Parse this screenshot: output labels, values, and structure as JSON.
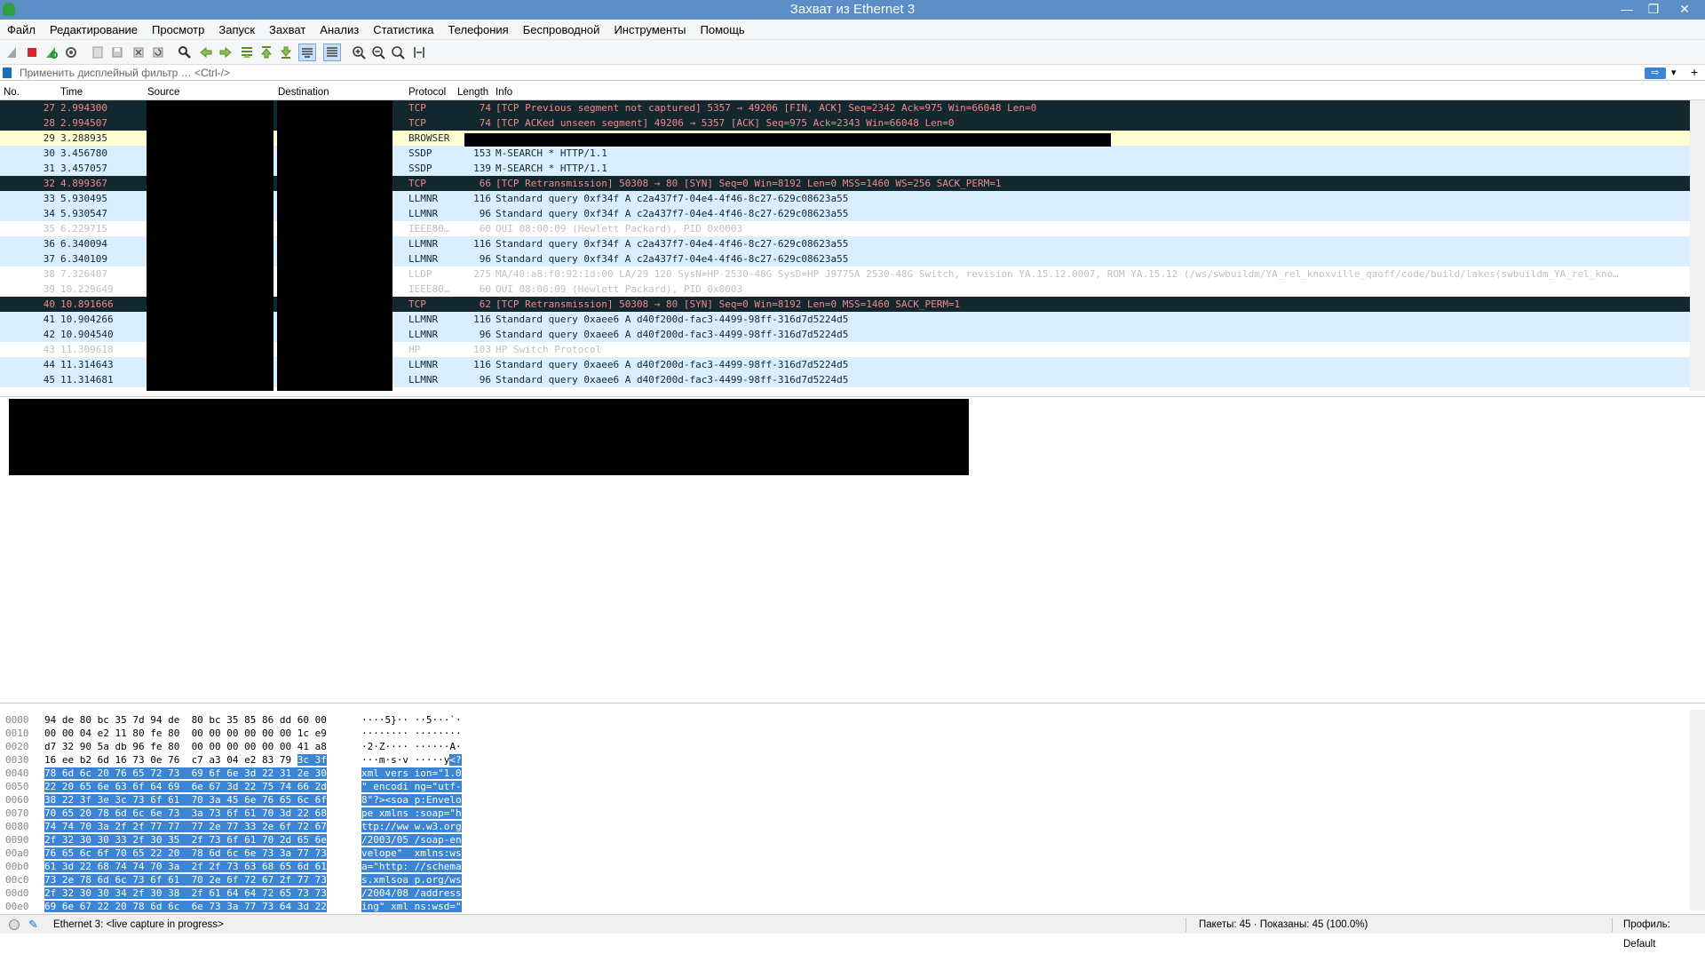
{
  "window": {
    "title": "Захват из Ethernet 3",
    "min": "—",
    "max": "❐",
    "close": "✕"
  },
  "menu": [
    "Файл",
    "Редактирование",
    "Просмотр",
    "Запуск",
    "Захват",
    "Анализ",
    "Статистика",
    "Телефония",
    "Беспроводной",
    "Инструменты",
    "Помощь"
  ],
  "filter": {
    "placeholder": "Применить дисплейный фильтр … <Ctrl-/>",
    "apply": "⇨",
    "dropdown": "▾",
    "add": "+"
  },
  "columns": {
    "no": "No.",
    "time": "Time",
    "source": "Source",
    "destination": "Destination",
    "protocol": "Protocol",
    "length": "Length",
    "info": "Info"
  },
  "packets": [
    {
      "no": "27",
      "time": "2.994300",
      "proto": "TCP",
      "len": "74",
      "info": "[TCP Previous segment not captured] 5357 → 49206 [FIN, ACK] Seq=2342 Ack=975 Win=66048 Len=0",
      "style": "tcpdark"
    },
    {
      "no": "28",
      "time": "2.994507",
      "proto": "TCP",
      "len": "74",
      "info": "[TCP ACKed unseen segment] 49206 → 5357 [ACK] Seq=975 Ack=2343 Win=66048 Len=0",
      "style": "tcpdark"
    },
    {
      "no": "29",
      "time": "3.288935",
      "proto": "BROWSER",
      "len": "",
      "info": "",
      "style": "yellow"
    },
    {
      "no": "30",
      "time": "3.456780",
      "proto": "SSDP",
      "len": "153",
      "info": "M-SEARCH * HTTP/1.1",
      "style": "blue"
    },
    {
      "no": "31",
      "time": "3.457057",
      "proto": "SSDP",
      "len": "139",
      "info": "M-SEARCH * HTTP/1.1",
      "style": "blue"
    },
    {
      "no": "32",
      "time": "4.899367",
      "proto": "TCP",
      "len": "66",
      "info": "[TCP Retransmission] 50308 → 80 [SYN] Seq=0 Win=8192 Len=0 MSS=1460 WS=256 SACK_PERM=1",
      "style": "tcpdark"
    },
    {
      "no": "33",
      "time": "5.930495",
      "proto": "LLMNR",
      "len": "116",
      "info": "Standard query 0xf34f A c2a437f7-04e4-4f46-8c27-629c08623a55",
      "style": "blue"
    },
    {
      "no": "34",
      "time": "5.930547",
      "proto": "LLMNR",
      "len": "96",
      "info": "Standard query 0xf34f A c2a437f7-04e4-4f46-8c27-629c08623a55",
      "style": "blue"
    },
    {
      "no": "35",
      "time": "6.229715",
      "proto": "IEEE80…",
      "len": "60",
      "info": "OUI 08:00:09 (Hewlett Packard), PID 0x0003",
      "style": "white"
    },
    {
      "no": "36",
      "time": "6.340094",
      "proto": "LLMNR",
      "len": "116",
      "info": "Standard query 0xf34f A c2a437f7-04e4-4f46-8c27-629c08623a55",
      "style": "blue"
    },
    {
      "no": "37",
      "time": "6.340109",
      "proto": "LLMNR",
      "len": "96",
      "info": "Standard query 0xf34f A c2a437f7-04e4-4f46-8c27-629c08623a55",
      "style": "blue"
    },
    {
      "no": "38",
      "time": "7.326407",
      "proto": "LLDP",
      "len": "275",
      "info": "MA/40:a8:f0:92:1d:00 LA/29 120 SysN=HP-2530-48G SysD=HP J9775A 2530-48G Switch, revision YA.15.12.0007, ROM YA.15.12 (/ws/swbuildm/YA_rel_knoxville_qaoff/code/build/lakes(swbuildm_YA_rel_kno…",
      "style": "white"
    },
    {
      "no": "39",
      "time": "10.229649",
      "proto": "IEEE80…",
      "len": "60",
      "info": "OUI 08:00:09 (Hewlett Packard), PID 0x0003",
      "style": "white"
    },
    {
      "no": "40",
      "time": "10.891666",
      "proto": "TCP",
      "len": "62",
      "info": "[TCP Retransmission] 50308 → 80 [SYN] Seq=0 Win=8192 Len=0 MSS=1460 SACK_PERM=1",
      "style": "tcpdark"
    },
    {
      "no": "41",
      "time": "10.904266",
      "proto": "LLMNR",
      "len": "116",
      "info": "Standard query 0xaee6 A d40f200d-fac3-4499-98ff-316d7d5224d5",
      "style": "blue"
    },
    {
      "no": "42",
      "time": "10.904540",
      "proto": "LLMNR",
      "len": "96",
      "info": "Standard query 0xaee6 A d40f200d-fac3-4499-98ff-316d7d5224d5",
      "style": "blue"
    },
    {
      "no": "43",
      "time": "11.309618",
      "proto": "HP",
      "len": "103",
      "info": "HP Switch Protocol",
      "style": "white"
    },
    {
      "no": "44",
      "time": "11.314643",
      "proto": "LLMNR",
      "len": "116",
      "info": "Standard query 0xaee6 A d40f200d-fac3-4499-98ff-316d7d5224d5",
      "style": "blue"
    },
    {
      "no": "45",
      "time": "11.314681",
      "proto": "LLMNR",
      "len": "96",
      "info": "Standard query 0xaee6 A d40f200d-fac3-4499-98ff-316d7d5224d5",
      "style": "blue"
    }
  ],
  "hex": [
    {
      "off": "0000",
      "b1": "94 de 80 bc 35 7d 94 de  80 bc 35 85 86 dd 60 00",
      "b1h": "",
      "a1": "····5}·· ··5···`·",
      "a1h": ""
    },
    {
      "off": "0010",
      "b1": "00 00 04 e2 11 80 fe 80  00 00 00 00 00 00 1c e9",
      "b1h": "",
      "a1": "········ ········",
      "a1h": ""
    },
    {
      "off": "0020",
      "b1": "d7 32 90 5a db 96 fe 80  00 00 00 00 00 00 41 a8",
      "b1h": "",
      "a1": "·2·Z···· ······A·",
      "a1h": ""
    },
    {
      "off": "0030",
      "b1": "16 ee b2 6d 16 73 0e 76  c7 a3 04 e2 83 79 ",
      "b1h": "3c 3f",
      "a1": "···m·s·v ·····y",
      "a1h": "<?"
    },
    {
      "off": "0040",
      "b1": "",
      "b1h": "78 6d 6c 20 76 65 72 73  69 6f 6e 3d 22 31 2e 30",
      "a1": "",
      "a1h": "xml vers ion=\"1.0"
    },
    {
      "off": "0050",
      "b1": "",
      "b1h": "22 20 65 6e 63 6f 64 69  6e 67 3d 22 75 74 66 2d",
      "a1": "",
      "a1h": "\" encodi ng=\"utf-"
    },
    {
      "off": "0060",
      "b1": "",
      "b1h": "38 22 3f 3e 3c 73 6f 61  70 3a 45 6e 76 65 6c 6f",
      "a1": "",
      "a1h": "8\"?><soa p:Envelo"
    },
    {
      "off": "0070",
      "b1": "",
      "b1h": "70 65 20 78 6d 6c 6e 73  3a 73 6f 61 70 3d 22 68",
      "a1": "",
      "a1h": "pe xmlns :soap=\"h"
    },
    {
      "off": "0080",
      "b1": "",
      "b1h": "74 74 70 3a 2f 2f 77 77  77 2e 77 33 2e 6f 72 67",
      "a1": "",
      "a1h": "ttp://ww w.w3.org"
    },
    {
      "off": "0090",
      "b1": "",
      "b1h": "2f 32 30 30 33 2f 30 35  2f 73 6f 61 70 2d 65 6e",
      "a1": "",
      "a1h": "/2003/05 /soap-en"
    },
    {
      "off": "00a0",
      "b1": "",
      "b1h": "76 65 6c 6f 70 65 22 20  78 6d 6c 6e 73 3a 77 73",
      "a1": "",
      "a1h": "velope\"  xmlns:ws"
    },
    {
      "off": "00b0",
      "b1": "",
      "b1h": "61 3d 22 68 74 74 70 3a  2f 2f 73 63 68 65 6d 61",
      "a1": "",
      "a1h": "a=\"http: //schema"
    },
    {
      "off": "00c0",
      "b1": "",
      "b1h": "73 2e 78 6d 6c 73 6f 61  70 2e 6f 72 67 2f 77 73",
      "a1": "",
      "a1h": "s.xmlsoa p.org/ws"
    },
    {
      "off": "00d0",
      "b1": "",
      "b1h": "2f 32 30 30 34 2f 30 38  2f 61 64 64 72 65 73 73",
      "a1": "",
      "a1h": "/2004/08 /address"
    },
    {
      "off": "00e0",
      "b1": "",
      "b1h": "69 6e 67 22 20 78 6d 6c  6e 73 3a 77 73 64 3d 22",
      "a1": "",
      "a1h": "ing\" xml ns:wsd=\""
    }
  ],
  "status": {
    "interface": "Ethernet 3: <live capture in progress>",
    "packets": "Пакеты: 45 · Показаны: 45 (100.0%)",
    "profile": "Профиль: Default"
  },
  "colors": {
    "titlebar": "#5b8ec6",
    "tcp_bg": "#12272e",
    "tcp_fg": "#f78787",
    "udp_bg": "#daeeff",
    "browser_bg": "#feffd0",
    "hex_select": "#3c84d4"
  }
}
